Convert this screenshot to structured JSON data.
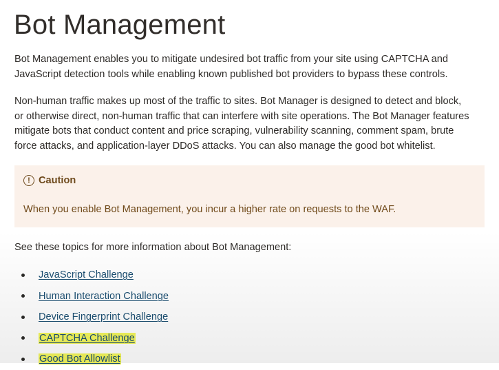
{
  "page": {
    "title": "Bot Management",
    "intro": "Bot Management enables you to mitigate undesired bot traffic from your site using CAPTCHA and JavaScript detection tools while enabling known published bot providers to bypass these controls.",
    "description": "Non-human traffic makes up most of the traffic to sites. Bot Manager is designed to detect and block, or otherwise direct, non-human traffic that can interfere with site operations. The Bot Manager features mitigate bots that conduct content and price scraping, vulnerability scanning, comment spam, brute force attacks, and application-layer DDoS attacks. You can also manage the good bot whitelist."
  },
  "caution": {
    "icon": "exclamation-circle-icon",
    "title": "Caution",
    "body": "When you enable Bot Management, you incur a higher rate on requests to the WAF."
  },
  "topics": {
    "intro": "See these topics for more information about Bot Management:",
    "links": [
      {
        "label": "JavaScript Challenge",
        "highlighted": false
      },
      {
        "label": "Human Interaction Challenge",
        "highlighted": false
      },
      {
        "label": "Device Fingerprint Challenge",
        "highlighted": false
      },
      {
        "label": "CAPTCHA Challenge",
        "highlighted": true
      },
      {
        "label": "Good Bot Allowlist",
        "highlighted": true
      }
    ]
  },
  "colors": {
    "caution_bg": "#fbf1ea",
    "caution_text": "#704a1a",
    "link": "#1b4f72",
    "highlight": "#f4f75c"
  }
}
